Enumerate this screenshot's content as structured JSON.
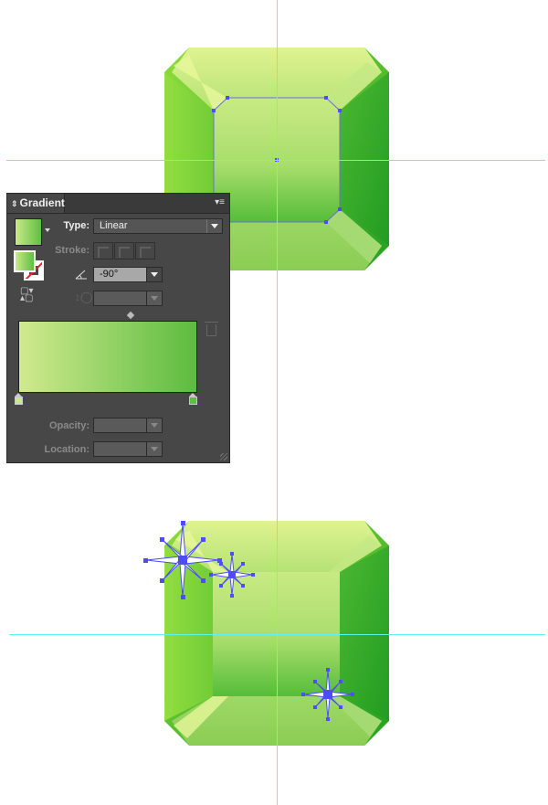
{
  "canvas": {
    "guides": {
      "vertical_count": 1,
      "horizontal_count": 2,
      "color": "#5ff2ef"
    },
    "gems": [
      {
        "name": "top-gem",
        "state": "inner facet selected",
        "colors": {
          "light": "#e4f597",
          "mid": "#7ed23f",
          "dark": "#24a024"
        }
      },
      {
        "name": "bottom-gem",
        "state": "with sparkles",
        "colors": {
          "light": "#e4f597",
          "mid": "#7ed23f",
          "dark": "#24a024"
        }
      }
    ],
    "sparkles": 3,
    "selection_color": "#4d4dff"
  },
  "panel": {
    "title": "Gradient",
    "menu_icon": "panel-menu-icon",
    "type_label": "Type:",
    "type_value": "Linear",
    "stroke_label": "Stroke:",
    "angle_value": "-90°",
    "aspect_value": "",
    "opacity_label": "Opacity:",
    "opacity_value": "",
    "location_label": "Location:",
    "location_value": "",
    "gradient": {
      "start_color": "#d1ea8e",
      "end_color": "#5cbc40",
      "stops": [
        {
          "position_percent": 0,
          "color": "#c9e98a"
        },
        {
          "position_percent": 100,
          "color": "#5fbf42"
        }
      ]
    }
  }
}
